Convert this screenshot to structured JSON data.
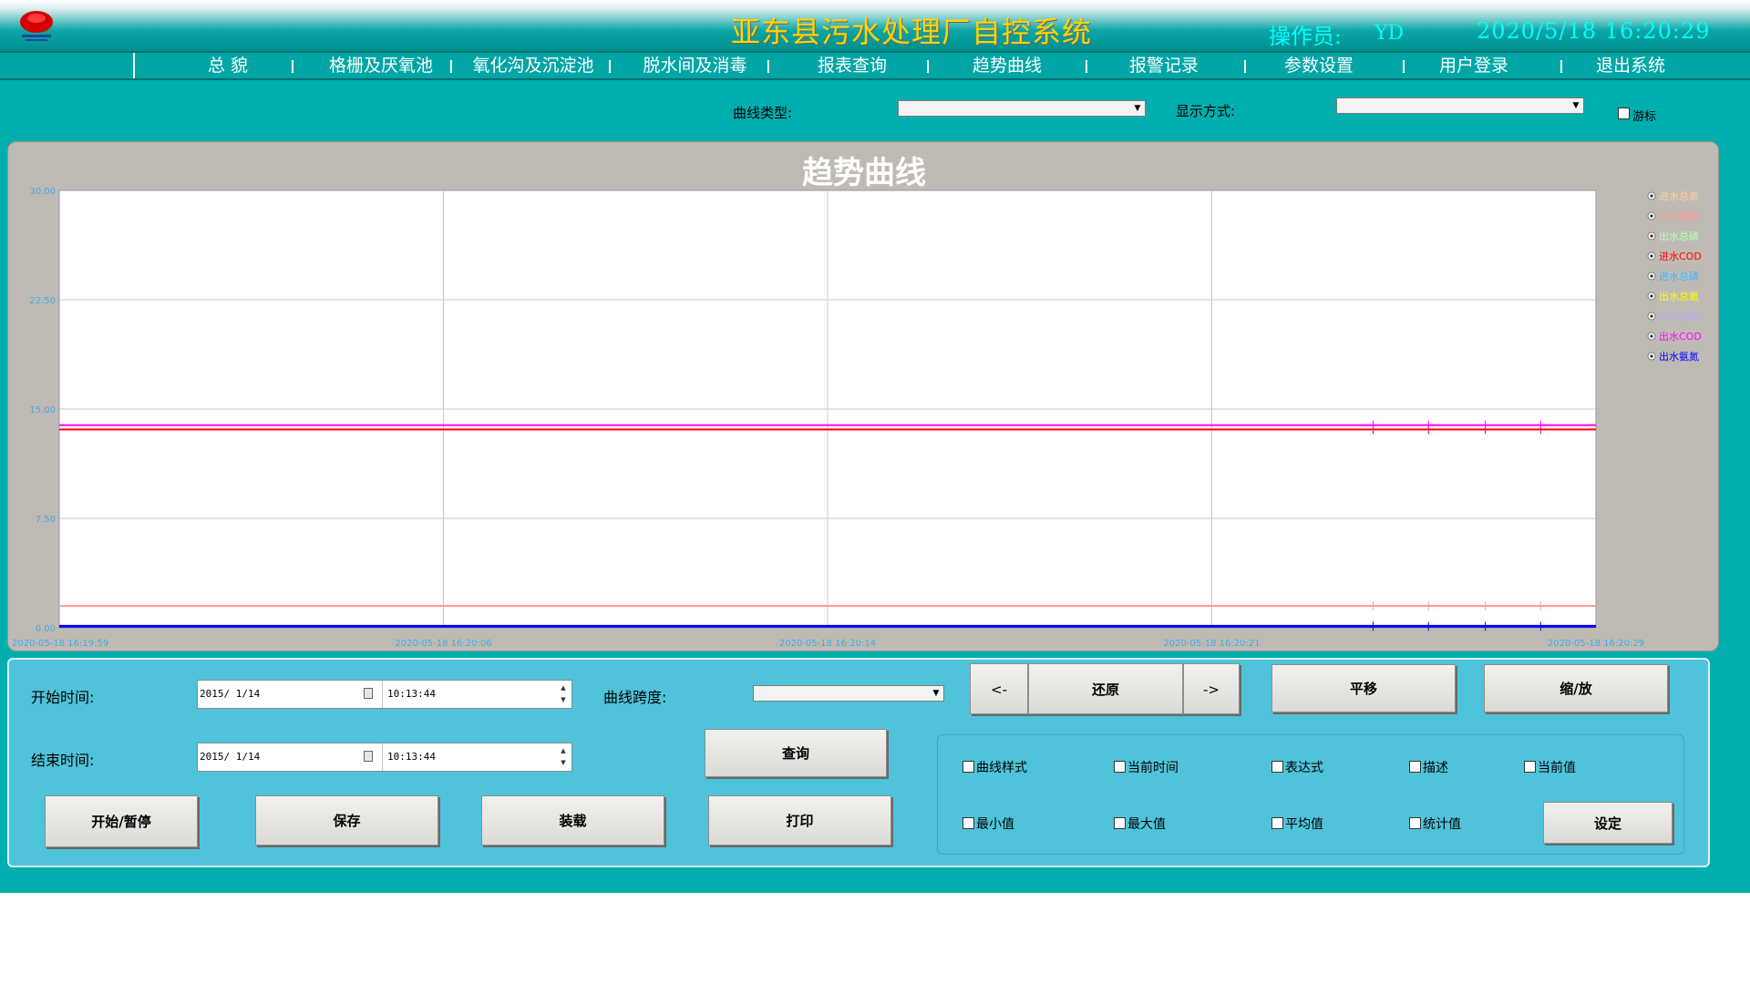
{
  "header": {
    "title": "亚东县污水处理厂自控系统",
    "operator_label": "操作员:",
    "operator": "YD",
    "datetime": "2020/5/18  16:20:29",
    "logo_icon": "red-company-logo-icon"
  },
  "nav": [
    {
      "label": "总  貌"
    },
    {
      "label": "格栅及厌氧池"
    },
    {
      "label": "氧化沟及沉淀池"
    },
    {
      "label": "脱水间及消毒"
    },
    {
      "label": "报表查询"
    },
    {
      "label": "趋势曲线"
    },
    {
      "label": "报警记录"
    },
    {
      "label": "参数设置"
    },
    {
      "label": "用户登录"
    },
    {
      "label": "退出系统"
    }
  ],
  "filters": {
    "curve_type_label": "曲线类型:",
    "curve_type_value": "",
    "display_mode_label": "显示方式:",
    "display_mode_value": "",
    "cursor_label": "游标",
    "cursor_checked": false
  },
  "chart_title": "趋势曲线",
  "chart_data": {
    "type": "line",
    "title": "趋势曲线",
    "ylim": [
      0,
      30
    ],
    "y_ticks": [
      "0.00",
      "7.50",
      "15.00",
      "22.50",
      "30.00"
    ],
    "x_ticks": [
      "2020-05-18 16:19:59",
      "2020-05-18 16:20:06",
      "2020-05-18 16:20:14",
      "2020-05-18 16:20:21",
      "2020-05-18 16:20:29"
    ],
    "grid": true,
    "legend_position": "right",
    "series": [
      {
        "name": "进水总氮",
        "color": "#ffd0a0",
        "values": []
      },
      {
        "name": "出水氨氮",
        "color": "#ff9a9a",
        "values": [
          1.5,
          1.5,
          1.5,
          1.5,
          1.5
        ]
      },
      {
        "name": "出水总磷",
        "color": "#b8ffb8",
        "values": []
      },
      {
        "name": "进水COD",
        "color": "#ff0000",
        "values": [
          13.6,
          13.6,
          13.6,
          13.6,
          13.6
        ]
      },
      {
        "name": "进水总磷",
        "color": "#3fb3ff",
        "values": []
      },
      {
        "name": "出水总氮",
        "color": "#ffff00",
        "values": []
      },
      {
        "name": "出水总磷",
        "color": "#c0a8ff",
        "values": []
      },
      {
        "name": "出水COD",
        "color": "#ff00ff",
        "values": [
          13.9,
          13.9,
          13.9,
          13.9,
          13.9
        ]
      },
      {
        "name": "出水氨氮",
        "color": "#0000ff",
        "values": [
          0.1,
          0.1,
          0.1,
          0.1,
          0.1
        ]
      }
    ]
  },
  "controls": {
    "start_label": "开始时间:",
    "start_date": "2015/ 1/14",
    "start_time": "10:13:44",
    "end_label": "结束时间:",
    "end_date": "2015/ 1/14",
    "end_time": "10:13:44",
    "span_label": "曲线跨度:",
    "span_value": "",
    "btn_prev": "<-",
    "btn_restore": "还原",
    "btn_next": "->",
    "btn_pan": "平移",
    "btn_zoom": "缩/放",
    "btn_query": "查询",
    "btn_start_pause": "开始/暂停",
    "btn_save": "保存",
    "btn_load": "装载",
    "btn_print": "打印",
    "btn_set": "设定",
    "options": [
      {
        "label": "曲线样式",
        "checked": false
      },
      {
        "label": "当前时间",
        "checked": false
      },
      {
        "label": "表达式",
        "checked": false
      },
      {
        "label": "描述",
        "checked": false
      },
      {
        "label": "当前值",
        "checked": false
      },
      {
        "label": "最小值",
        "checked": false
      },
      {
        "label": "最大值",
        "checked": false
      },
      {
        "label": "平均值",
        "checked": false
      },
      {
        "label": "统计值",
        "checked": false
      }
    ]
  }
}
